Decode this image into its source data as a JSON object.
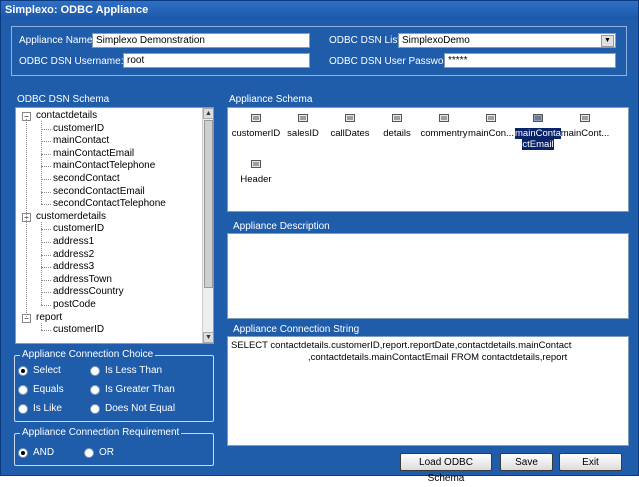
{
  "window": {
    "title": "Simplexo: ODBC Appliance"
  },
  "header": {
    "appliance_name_label": "Appliance Name:",
    "appliance_name_value": "Simplexo Demonstration",
    "username_label": "ODBC DSN Username:",
    "username_value": "root",
    "dsn_list_label": "ODBC DSN List:",
    "dsn_list_value": "SimplexoDemo",
    "password_label": "ODBC DSN User Password:",
    "password_value": "*****"
  },
  "dsn_schema": {
    "title": "ODBC DSN Schema",
    "groups": [
      {
        "name": "contactdetails",
        "fields": [
          "customerID",
          "mainContact",
          "mainContactEmail",
          "mainContactTelephone",
          "secondContact",
          "secondContactEmail",
          "secondContactTelephone"
        ]
      },
      {
        "name": "customerdetails",
        "fields": [
          "customerID",
          "address1",
          "address2",
          "address3",
          "addressTown",
          "addressCountry",
          "postCode"
        ]
      },
      {
        "name": "report",
        "fields": [
          "customerID"
        ]
      }
    ]
  },
  "appliance_schema": {
    "title": "Appliance Schema",
    "items": [
      "customerID",
      "salesID",
      "callDates",
      "details",
      "commentry",
      "mainCon...",
      "mainContactEmail",
      "mainCont...",
      "Header"
    ],
    "selected_index": 6,
    "selected_line1": "mainConta",
    "selected_line2": "ctEmail"
  },
  "description": {
    "title": "Appliance Description",
    "value": ""
  },
  "connection_string": {
    "title": "Appliance Connection String",
    "line1": "SELECT contactdetails.customerID,report.reportDate,contactdetails.mainContact",
    "line2": ",contactdetails.mainContactEmail FROM contactdetails,report"
  },
  "connection_choice": {
    "title": "Appliance Connection Choice",
    "options": [
      "Select",
      "Is Less Than",
      "Equals",
      "Is Greater Than",
      "Is Like",
      "Does Not Equal"
    ],
    "selected": "Select"
  },
  "connection_requirement": {
    "title": "Appliance Connection Requirement",
    "options": [
      "AND",
      "OR"
    ],
    "selected": "AND"
  },
  "buttons": {
    "load": "Load ODBC Schema",
    "save": "Save",
    "exit": "Exit"
  },
  "colors": {
    "window_bg": "#1f5dab",
    "selection": "#0a246a"
  }
}
